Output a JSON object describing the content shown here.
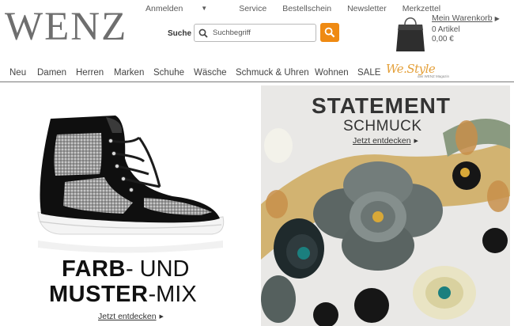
{
  "brand": {
    "logo": "WENZ"
  },
  "topnav": [
    {
      "label": "Anmelden",
      "has_caret": true
    },
    {
      "label": "Service"
    },
    {
      "label": "Bestellschein"
    },
    {
      "label": "Newsletter"
    },
    {
      "label": "Merkzettel"
    }
  ],
  "search": {
    "label": "Suche",
    "placeholder": "Suchbegriff",
    "button_icon": "search-icon",
    "button_color": "#ef8a12"
  },
  "cart": {
    "title": "Mein Warenkorb",
    "count_line": "0   Artikel",
    "total": "0,00 €",
    "icon": "shopping-bag-icon"
  },
  "mainnav": [
    {
      "label": "Neu"
    },
    {
      "label": "Damen"
    },
    {
      "label": "Herren"
    },
    {
      "label": "Marken"
    },
    {
      "label": "Schuhe"
    },
    {
      "label": "Wäsche"
    },
    {
      "label": "Schmuck & Uhren"
    },
    {
      "label": "Wohnen"
    },
    {
      "label": "SALE"
    }
  ],
  "westyle": {
    "logo": "We.Style",
    "sub": "das WENZ Magazin"
  },
  "banner_left": {
    "line1_bold": "FARB",
    "line1_thin": "- UND",
    "line2_bold": "MUSTER",
    "line2_thin": "-MIX",
    "cta": "Jetzt entdecken"
  },
  "banner_right": {
    "title": "STATEMENT",
    "subtitle": "SCHMUCK",
    "cta": "Jetzt entdecken"
  }
}
